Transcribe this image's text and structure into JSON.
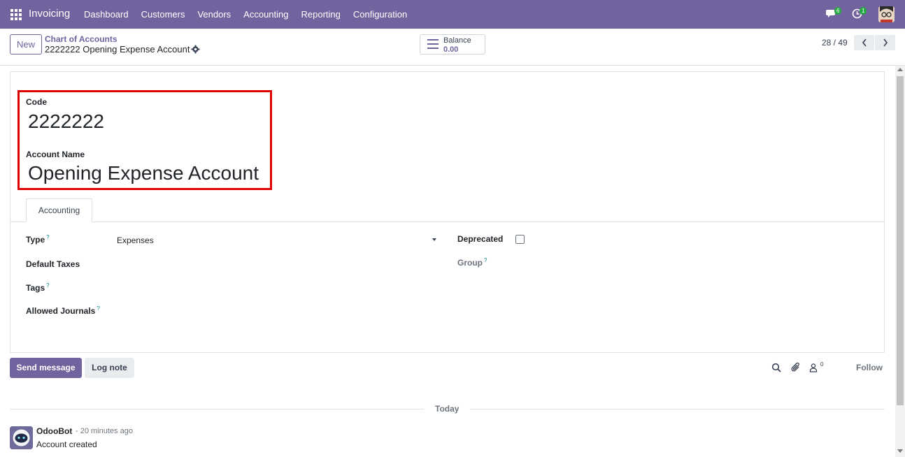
{
  "topbar": {
    "app_name": "Invoicing",
    "menu": [
      "Dashboard",
      "Customers",
      "Vendors",
      "Accounting",
      "Reporting",
      "Configuration"
    ],
    "messages_count": "6",
    "activities_count": "1",
    "color": "#71639e"
  },
  "control": {
    "new_label": "New",
    "breadcrumb_parent": "Chart of Accounts",
    "breadcrumb_current": "2222222 Opening Expense Account",
    "balance_label": "Balance",
    "balance_value": "0.00",
    "pager": "28 / 49"
  },
  "form": {
    "code_label": "Code",
    "code_value": "2222222",
    "name_label": "Account Name",
    "name_value": "Opening Expense Account",
    "tab_label": "Accounting",
    "type_label": "Type",
    "type_help": "?",
    "type_value": "Expenses",
    "default_taxes_label": "Default Taxes",
    "tags_label": "Tags",
    "tags_help": "?",
    "allowed_journals_label": "Allowed Journals",
    "allowed_journals_help": "?",
    "deprecated_label": "Deprecated",
    "deprecated_checked": false,
    "group_label": "Group",
    "group_help": "?"
  },
  "chatter": {
    "send_message_label": "Send message",
    "log_note_label": "Log note",
    "followers_count": "0",
    "follow_label": "Follow",
    "date_separator": "Today",
    "message_author": "OdooBot",
    "message_time": "- 20 minutes ago",
    "message_body": "Account created"
  },
  "colors": {
    "highlight": "#e00000",
    "accent": "#71639e"
  }
}
